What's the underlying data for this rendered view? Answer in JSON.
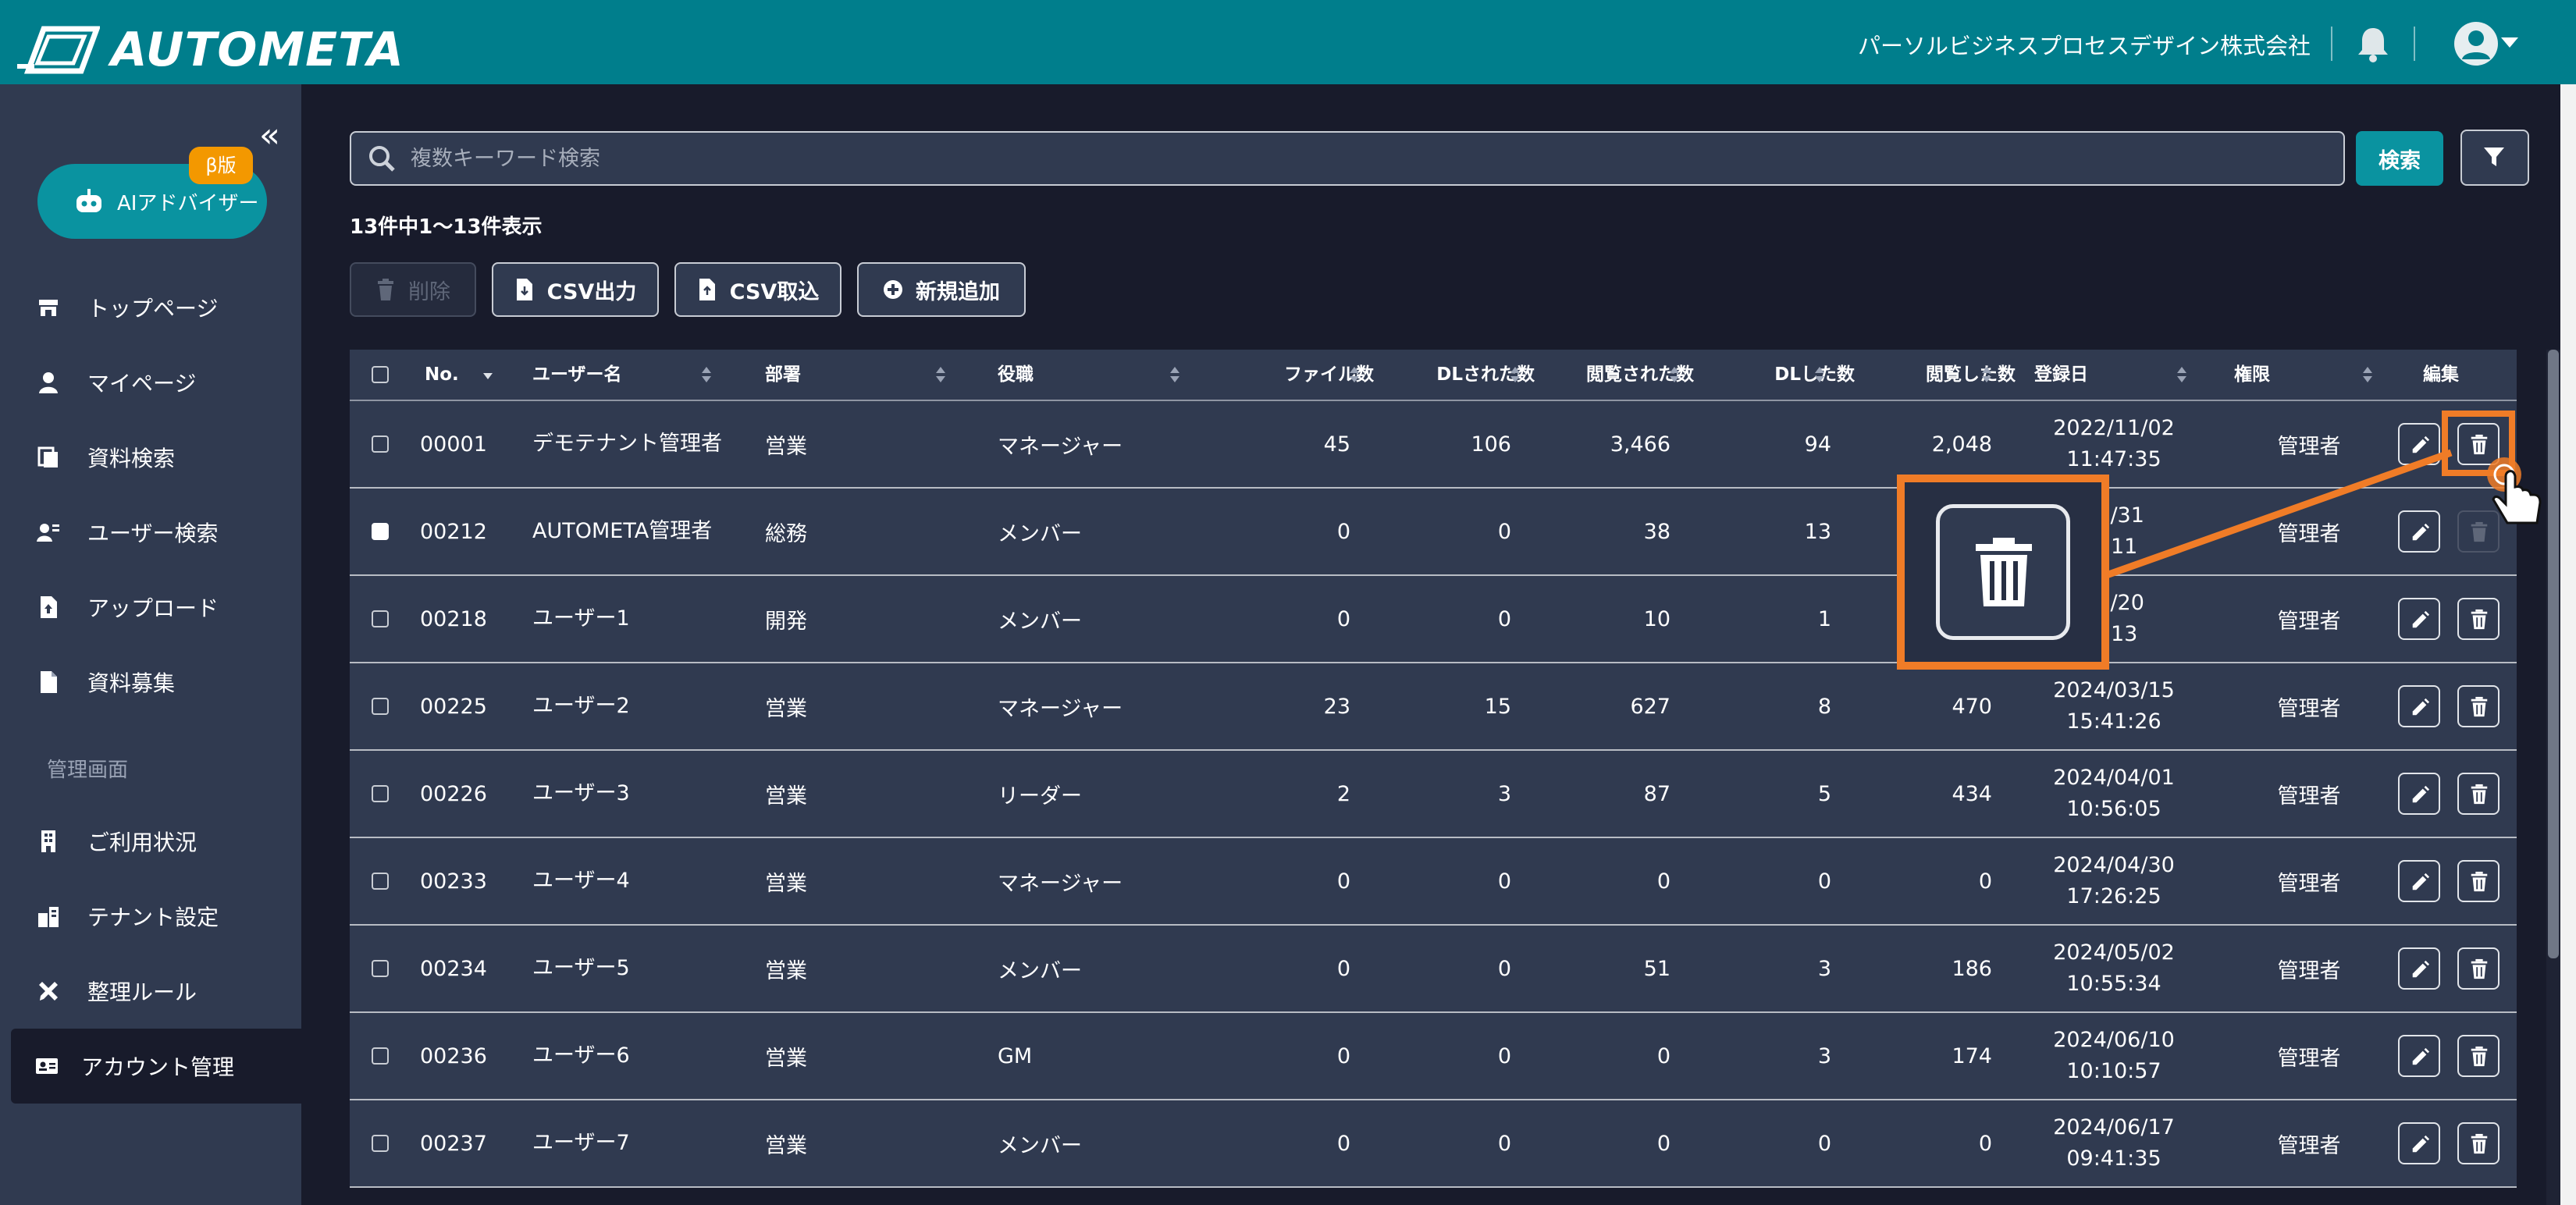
{
  "header": {
    "logo_text": "AUTOMETA",
    "company": "パーソルビジネスプロセスデザイン株式会社"
  },
  "sidebar": {
    "ai_button": "AIアドバイザー",
    "beta_badge": "β版",
    "section_label": "管理画面",
    "items": [
      {
        "label": "トップページ",
        "icon": "store-icon"
      },
      {
        "label": "マイページ",
        "icon": "person-icon"
      },
      {
        "label": "資料検索",
        "icon": "documents-icon"
      },
      {
        "label": "ユーザー検索",
        "icon": "user-search-icon"
      },
      {
        "label": "アップロード",
        "icon": "file-upload-icon"
      },
      {
        "label": "資料募集",
        "icon": "file-icon"
      },
      {
        "label": "ご利用状況",
        "icon": "building-icon"
      },
      {
        "label": "テナント設定",
        "icon": "tenant-icon"
      },
      {
        "label": "整理ルール",
        "icon": "tools-icon"
      },
      {
        "label": "アカウント管理",
        "icon": "id-card-icon"
      }
    ]
  },
  "search": {
    "placeholder": "複数キーワード検索",
    "button": "検索"
  },
  "count_text": "13件中1〜13件表示",
  "toolbar": {
    "delete": "削除",
    "csv_export": "CSV出力",
    "csv_import": "CSV取込",
    "add_new": "新規追加"
  },
  "table": {
    "columns": [
      "No.",
      "ユーザー名",
      "部署",
      "役職",
      "ファイル数",
      "DLされた数",
      "閲覧された数",
      "DLした数",
      "閲覧した数",
      "登録日",
      "権限",
      "編集"
    ],
    "rows": [
      {
        "no": "00001",
        "name": "デモテナント管理者",
        "dept": "営業",
        "role": "マネージャー",
        "files": "45",
        "dl_by": "106",
        "views_by": "3,466",
        "dl": "94",
        "views": "2,048",
        "date": "2022/11/02",
        "time": "11:47:35",
        "perm": "管理者"
      },
      {
        "no": "00212",
        "name": "AUTOMETA管理者",
        "dept": "総務",
        "role": "メンバー",
        "files": "0",
        "dl_by": "0",
        "views_by": "38",
        "dl": "13",
        "views": "",
        "date": "05/31",
        "time": "6:11",
        "perm": "管理者"
      },
      {
        "no": "00218",
        "name": "ユーザー1",
        "dept": "開発",
        "role": "メンバー",
        "files": "0",
        "dl_by": "0",
        "views_by": "10",
        "dl": "1",
        "views": "",
        "date": "12/20",
        "time": "6:13",
        "perm": "管理者"
      },
      {
        "no": "00225",
        "name": "ユーザー2",
        "dept": "営業",
        "role": "マネージャー",
        "files": "23",
        "dl_by": "15",
        "views_by": "627",
        "dl": "8",
        "views": "470",
        "date": "2024/03/15",
        "time": "15:41:26",
        "perm": "管理者"
      },
      {
        "no": "00226",
        "name": "ユーザー3",
        "dept": "営業",
        "role": "リーダー",
        "files": "2",
        "dl_by": "3",
        "views_by": "87",
        "dl": "5",
        "views": "434",
        "date": "2024/04/01",
        "time": "10:56:05",
        "perm": "管理者"
      },
      {
        "no": "00233",
        "name": "ユーザー4",
        "dept": "営業",
        "role": "マネージャー",
        "files": "0",
        "dl_by": "0",
        "views_by": "0",
        "dl": "0",
        "views": "0",
        "date": "2024/04/30",
        "time": "17:26:25",
        "perm": "管理者"
      },
      {
        "no": "00234",
        "name": "ユーザー5",
        "dept": "営業",
        "role": "メンバー",
        "files": "0",
        "dl_by": "0",
        "views_by": "51",
        "dl": "3",
        "views": "186",
        "date": "2024/05/02",
        "time": "10:55:34",
        "perm": "管理者"
      },
      {
        "no": "00236",
        "name": "ユーザー6",
        "dept": "営業",
        "role": "GM",
        "files": "0",
        "dl_by": "0",
        "views_by": "0",
        "dl": "3",
        "views": "174",
        "date": "2024/06/10",
        "time": "10:10:57",
        "perm": "管理者"
      },
      {
        "no": "00237",
        "name": "ユーザー7",
        "dept": "営業",
        "role": "メンバー",
        "files": "0",
        "dl_by": "0",
        "views_by": "0",
        "dl": "0",
        "views": "0",
        "date": "2024/06/17",
        "time": "09:41:35",
        "perm": "管理者"
      }
    ]
  },
  "colors": {
    "header": "#007e8c",
    "accent": "#0a93a0",
    "highlight": "#f07c27",
    "beta": "#f39800"
  }
}
